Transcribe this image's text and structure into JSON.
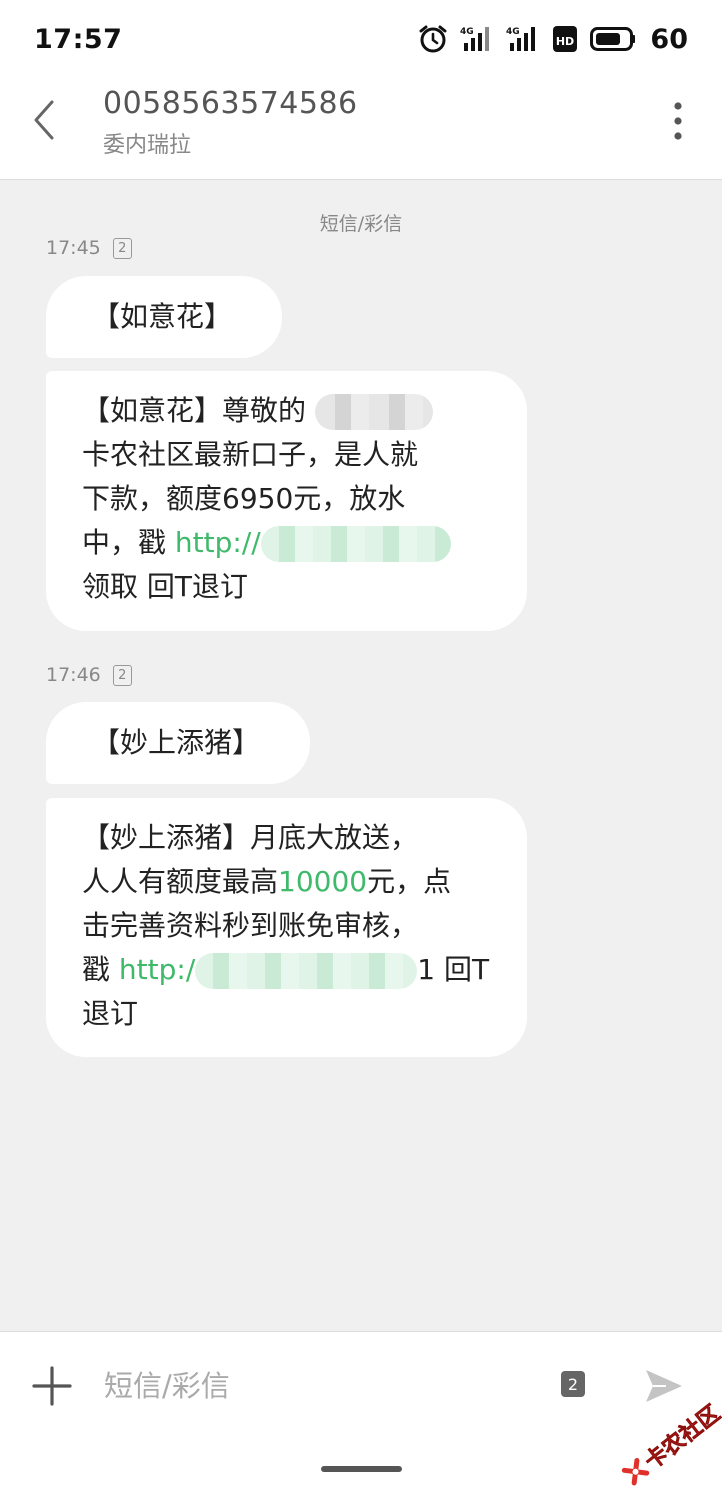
{
  "status_bar": {
    "time": "17:57",
    "network_1": "4G",
    "network_2": "4G",
    "hd_label": "HD",
    "battery": "60"
  },
  "header": {
    "number": "0058563574586",
    "subtitle": "委内瑞拉"
  },
  "thread": {
    "type_label": "短信/彩信",
    "groups": [
      {
        "time": "17:45",
        "sim": "2",
        "title": "【如意花】",
        "message": {
          "line1": "【如意花】尊敬的",
          "line2": "卡农社区最新口子，是人就",
          "line3": "下款，额度6950元，放水",
          "line4_prefix": "中，戳 ",
          "line4_link": "http://",
          "line5": "领取 回T退订"
        }
      },
      {
        "time": "17:46",
        "sim": "2",
        "title": "【妙上添猪】",
        "message": {
          "line1": "【妙上添猪】月底大放送，",
          "line2_prefix": "人人有额度最高",
          "line2_amount": "10000",
          "line2_suffix": "元，点",
          "line3": "击完善资料秒到账免审核，",
          "line4_prefix": "戳 ",
          "line4_link": "http:/",
          "line4_suffix": "1 回T",
          "line5": "退订"
        }
      }
    ]
  },
  "input_bar": {
    "placeholder": "短信/彩信",
    "sim_badge": "2"
  },
  "watermark": {
    "text": "卡农社区"
  },
  "colors": {
    "link": "#3fb96a",
    "background": "#f0f0f0",
    "bubble": "#ffffff",
    "watermark": "#e0302a"
  }
}
